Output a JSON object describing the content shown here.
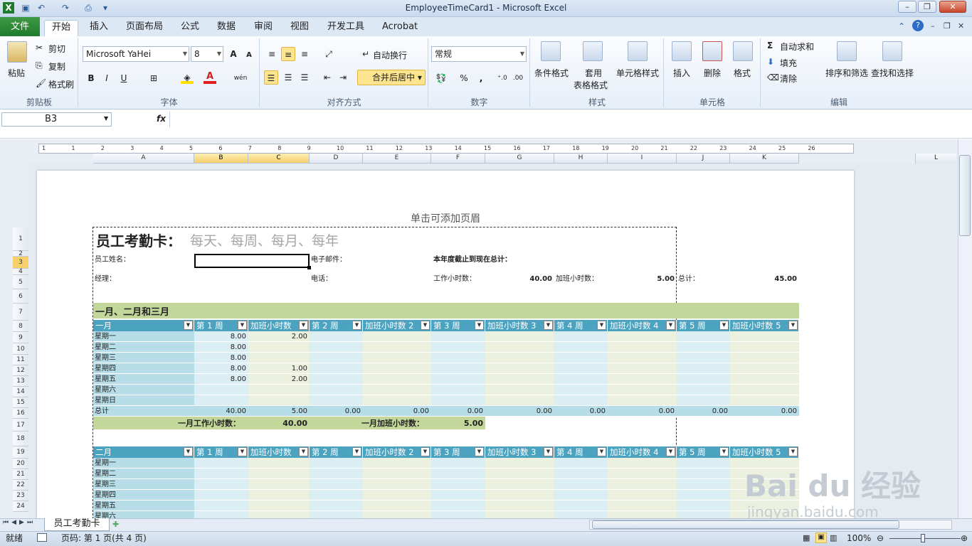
{
  "window": {
    "title": "EmployeeTimeCard1  -  Microsoft Excel"
  },
  "tabs": {
    "file": "文件",
    "items": [
      "开始",
      "插入",
      "页面布局",
      "公式",
      "数据",
      "审阅",
      "视图",
      "开发工具",
      "Acrobat"
    ]
  },
  "ribbon": {
    "clipboard": {
      "label": "剪贴板",
      "paste": "粘贴",
      "cut": "剪切",
      "copy": "复制",
      "painter": "格式刷"
    },
    "font": {
      "label": "字体",
      "name": "Microsoft YaHei",
      "size": "8",
      "bold": "B",
      "italic": "I",
      "underline": "U",
      "grow": "A",
      "shrink": "A"
    },
    "align": {
      "label": "对齐方式",
      "wrap": "自动换行",
      "merge": "合并后居中"
    },
    "number": {
      "label": "数字",
      "format": "常规",
      "percent": "%",
      "comma": ","
    },
    "styles": {
      "label": "样式",
      "cond": "条件格式",
      "table_l1": "套用",
      "table_l2": "表格格式",
      "cell": "单元格样式"
    },
    "cells": {
      "label": "单元格",
      "insert": "插入",
      "delete": "删除",
      "format": "格式"
    },
    "editing": {
      "label": "编辑",
      "autosum": "自动求和",
      "fill": "填充",
      "clear": "清除",
      "sort": "排序和筛选",
      "find": "查找和选择"
    }
  },
  "formula": {
    "namebox": "B3",
    "fx": "fx",
    "value": ""
  },
  "ruler": {
    "ticks": [
      "1",
      "1",
      "2",
      "3",
      "4",
      "5",
      "6",
      "7",
      "8",
      "9",
      "10",
      "11",
      "12",
      "13",
      "14",
      "15",
      "16",
      "17",
      "18",
      "19",
      "20",
      "21",
      "22",
      "23",
      "24",
      "25",
      "26"
    ]
  },
  "columns": [
    "A",
    "B",
    "C",
    "D",
    "E",
    "F",
    "G",
    "H",
    "I",
    "J",
    "K",
    "L"
  ],
  "rows": [
    "1",
    "2",
    "3",
    "4",
    "5",
    "6",
    "7",
    "8",
    "9",
    "10",
    "11",
    "12",
    "13",
    "14",
    "15",
    "16",
    "17",
    "18",
    "19",
    "20",
    "21",
    "22",
    "23",
    "24"
  ],
  "page": {
    "header_hint": "单击可添加页眉",
    "title": "员工考勤卡：",
    "subtitle": "每天、每周、每月、每年",
    "employee_label": "员工姓名：",
    "email_label": "电子邮件：",
    "ytd_label": "本年度截止到现在总计：",
    "manager_label": "经理：",
    "phone_label": "电话：",
    "work_hours_label": "工作小时数：",
    "work_hours": "40.00",
    "ot_label": "加班小时数：",
    "ot": "5.00",
    "total_label": "总计：",
    "total": "45.00",
    "quarter_title": "一月、二月和三月",
    "jan": {
      "name": "一月",
      "headers": [
        "第 1 周",
        "加班小时数",
        "第 2 周",
        "加班小时数 2",
        "第 3 周",
        "加班小时数 3",
        "第 4 周",
        "加班小时数 4",
        "第 5 周",
        "加班小时数 5"
      ],
      "days": [
        "星期一",
        "星期二",
        "星期三",
        "星期四",
        "星期五",
        "星期六",
        "星期日"
      ],
      "w1": [
        "8.00",
        "8.00",
        "8.00",
        "8.00",
        "8.00",
        "",
        ""
      ],
      "ot1": [
        "2.00",
        "",
        "",
        "1.00",
        "2.00",
        "",
        ""
      ],
      "total_label": "总计",
      "totals": [
        "40.00",
        "5.00",
        "0.00",
        "0.00",
        "0.00",
        "0.00",
        "0.00",
        "0.00",
        "0.00",
        "0.00"
      ],
      "work_sum_label": "一月工作小时数：",
      "work_sum": "40.00",
      "ot_sum_label": "一月加班小时数：",
      "ot_sum": "5.00"
    },
    "feb": {
      "name": "二月",
      "days": [
        "星期一",
        "星期二",
        "星期三",
        "星期四",
        "星期五",
        "星期六"
      ]
    }
  },
  "sheet": {
    "tab": "员工考勤卡"
  },
  "status": {
    "ready": "就绪",
    "page": "页码: 第 1 页(共 4 页)",
    "zoom": "100%"
  },
  "watermark": {
    "text": "Bai du 经验",
    "url": "jingyan.baidu.com"
  }
}
